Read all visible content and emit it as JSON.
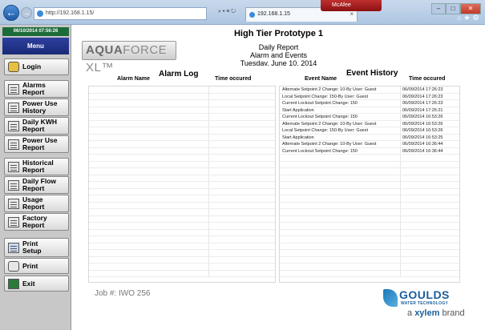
{
  "browser": {
    "address": "http://192.168.1.15/",
    "address_controls": "⌕ • ≡ ↻",
    "tab_title": "192.168.1.15",
    "tab_close": "×",
    "mcafee": "McAfee",
    "win_min": "–",
    "win_max": "□",
    "win_close": "✕",
    "toolbar_icons": "⌂★⚙"
  },
  "sidebar": {
    "datetime": "06/10/2014 07:56:26",
    "menu": "Menu",
    "login": "Login",
    "alarms_1": "Alarms",
    "alarms_2": "Report",
    "poweruse_hist_1": "Power Use",
    "poweruse_hist_2": "History",
    "dailykwh_1": "Daily KWH",
    "dailykwh_2": "Report",
    "poweruse_rep_1": "Power Use",
    "poweruse_rep_2": "Report",
    "historical_1": "Historical",
    "historical_2": "Report",
    "dailyflow_1": "Daily Flow",
    "dailyflow_2": "Report",
    "usage_1": "Usage",
    "usage_2": "Report",
    "factory_1": "Factory",
    "factory_2": "Report",
    "printsetup_1": "Print",
    "printsetup_2": "Setup",
    "print": "Print",
    "exit": "Exit"
  },
  "header": {
    "logo_bold": "AQUA",
    "logo_rest": "FORCE XL™",
    "title": "High Tier Prototype 1",
    "report": "Daily Report",
    "subtitle": "Alarm and Events",
    "date": "Tuesdav. June 10. 2014"
  },
  "alarm_log": {
    "title": "Alarm Log",
    "col_name": "Alarm Name",
    "col_time": "Time occured"
  },
  "event_history": {
    "title": "Event History",
    "col_name": "Event Name",
    "col_time": "Time occured",
    "rows": [
      [
        "Alternate Setpoint 2 Change: 10-By User:   Guest",
        "06/09/2014 17:26:23"
      ],
      [
        "Local Setpoint Change: 150-By User:   Guest",
        "06/09/2014 17:26:23"
      ],
      [
        "Current Lockout Setpoint Change: 150",
        "06/09/2014 17:26:23"
      ],
      [
        "Start Application",
        "06/09/2014 17:26:21"
      ],
      [
        "Current Lockout Setpoint Change: 150",
        "06/09/2014 16:53:26"
      ],
      [
        "Alternate Setpoint 2 Change: 10-By User:   Guest",
        "06/09/2014 16:53:26"
      ],
      [
        "Local Setpoint Change: 150-By User:   Guest",
        "06/09/2014 16:53:26"
      ],
      [
        "Start Application",
        "06/09/2014 16:53:25"
      ],
      [
        "Alternate Setpoint 2 Change: 10-By User:   Guest",
        "06/09/2014 16:36:44"
      ],
      [
        "Current Lockout Setpoint Change: 150",
        "06/09/2014 16:36:44"
      ]
    ]
  },
  "footer": {
    "job": "Job #: IWO 256",
    "goulds": "GOULDS",
    "goulds_sub": "WATER TECHNOLOGY",
    "brand_pre": "a ",
    "brand_bold": "xylem",
    "brand_post": " brand"
  }
}
